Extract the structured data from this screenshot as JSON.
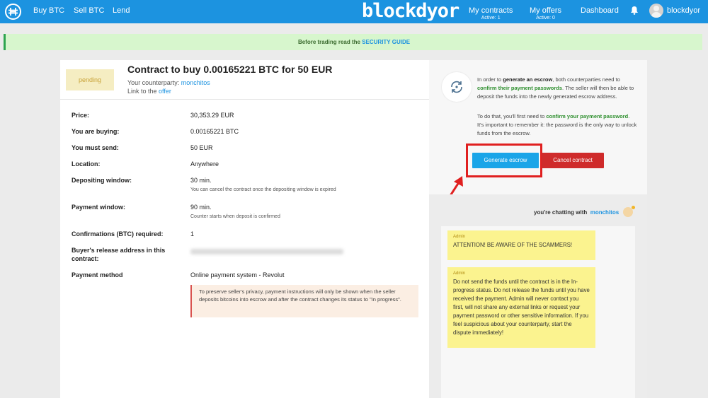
{
  "nav": {
    "brand": "blockdyor",
    "links": [
      "Buy BTC",
      "Sell BTC",
      "Lend"
    ],
    "my_contracts": {
      "label": "My contracts",
      "sub": "Active: 1"
    },
    "my_offers": {
      "label": "My offers",
      "sub": "Active: 0"
    },
    "dashboard": "Dashboard",
    "username": "blockdyor"
  },
  "banner": {
    "text": "Before trading read the",
    "link": "SECURITY GUIDE"
  },
  "contract": {
    "status": "pending",
    "title": "Contract to buy 0.00165221 BTC for 50 EUR",
    "counterparty_label": "Your counterparty:",
    "counterparty": "monchitos",
    "offer_prefix": "Link to the",
    "offer_link": "offer",
    "rows": [
      {
        "label": "Price:",
        "value": "30,353.29 EUR"
      },
      {
        "label": "You are buying:",
        "value": "0.00165221 BTC"
      },
      {
        "label": "You must send:",
        "value": "50 EUR"
      },
      {
        "label": "Location:",
        "value": "Anywhere"
      },
      {
        "label": "Depositing window:",
        "value": "30 min.",
        "note": "You can cancel the contract once the depositing window is expired"
      },
      {
        "label": "Payment window:",
        "value": "90 min.",
        "note": "Counter starts when deposit is confirmed"
      },
      {
        "label": "Confirmations (BTC) required:",
        "value": "1"
      },
      {
        "label": "Buyer's release address in this contract:",
        "value": ""
      },
      {
        "label": "Payment method",
        "value": "Online payment system - Revolut"
      }
    ],
    "notice": "To preserve seller's privacy, payment instructions will only be shown when the seller deposits bitcoins into escrow and after the contract changes its status to \"In progress\"."
  },
  "escrow": {
    "p1_a": "In order to ",
    "p1_b": "generate an escrow",
    "p1_c": ", both counterparties need to ",
    "p1_d": "confirm their payment passwords",
    "p1_e": ". The seller will then be able to deposit the funds into the newly generated escrow address.",
    "p2_a": "To do that, you'll first need to ",
    "p2_b": "confirm your payment password",
    "p2_c": ". It's important to remember it: the password is the only way to unlock funds from the escrow.",
    "generate_button": "Generate escrow",
    "cancel_button": "Cancel contract"
  },
  "chat": {
    "chatting_prefix": "you're chatting with",
    "partner": "monchitos",
    "messages": [
      {
        "author": "Admin",
        "text": "ATTENTION! BE AWARE OF THE SCAMMERS!"
      },
      {
        "author": "Admin",
        "text": "Do not send the funds until the contract is in the In-progress status. Do not release the funds until you have received the payment. Admin will never contact you first, will not share any external links or request your payment password or other sensitive information. If you feel suspicious about your counterparty, start the dispute immediately!"
      }
    ]
  },
  "colors": {
    "nav_blue": "#1c93e0",
    "generate_button": "#1aa5e8",
    "cancel_button": "#cf2b2b",
    "highlight_red": "#e02020",
    "admin_message": "#fbf38f",
    "banner_green": "#d7f6cd"
  },
  "icons": {
    "logo": "hodl-logo-icon",
    "bell": "bell-icon",
    "escrow": "escrow-refresh-icon",
    "annotation": "red-arrow-annotation"
  }
}
